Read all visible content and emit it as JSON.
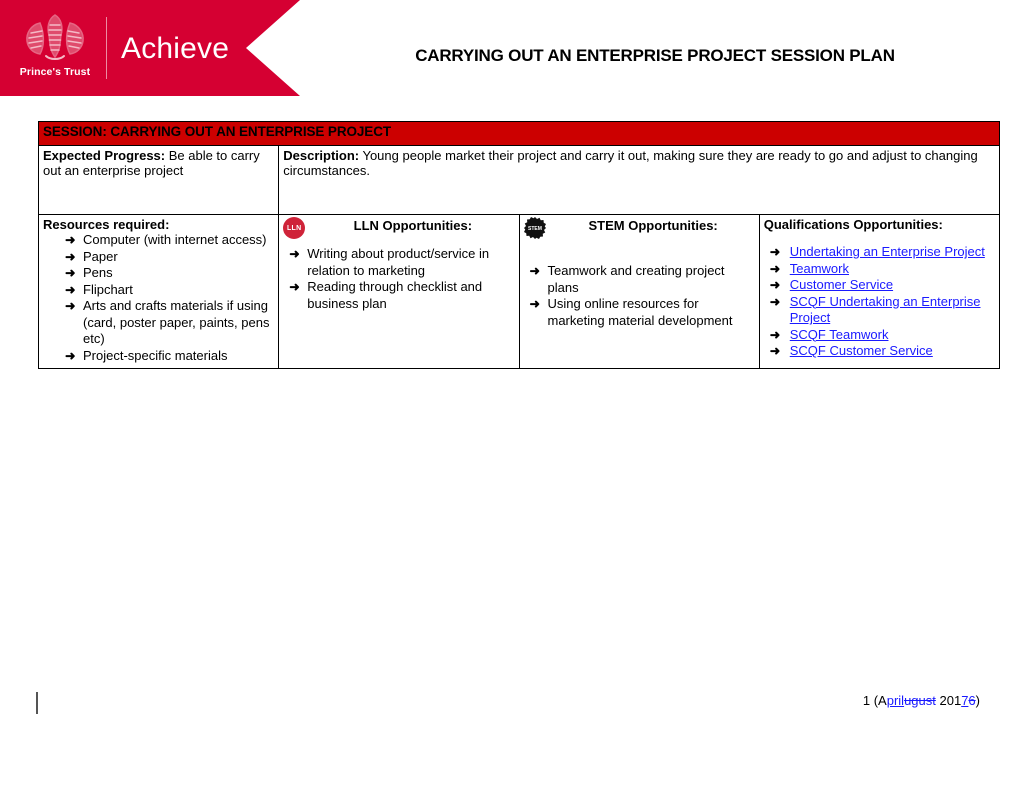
{
  "header": {
    "logo_wordmark": "Prince's Trust",
    "brand": "Achieve",
    "brand_color": "#d50032",
    "document_title": "CARRYING OUT AN ENTERPRISE PROJECT SESSION PLAN"
  },
  "table": {
    "session_header": "SESSION: CARRYING OUT AN ENTERPRISE PROJECT",
    "session_header_bg": "#cc0000",
    "expected_progress": {
      "label": "Expected Progress:",
      "text": " Be able to carry out an enterprise project"
    },
    "description": {
      "label": "Description:",
      "text": " Young people market their project and carry it out, making sure they are ready to go and adjust to changing circumstances."
    },
    "resources": {
      "label": "Resources required:",
      "items": [
        "Computer (with internet access)",
        "Paper",
        "Pens",
        "Flipchart",
        "Arts and crafts materials if using (card, poster paper, paints, pens etc)",
        "Project-specific materials"
      ]
    },
    "lln": {
      "badge": "LLN",
      "badge_color": "#cf2339",
      "label": "LLN Opportunities:",
      "items": [
        "Writing about product/service in relation to marketing",
        "Reading through checklist and business plan"
      ]
    },
    "stem": {
      "badge": "STEM",
      "badge_color": "#000000",
      "label": "STEM Opportunities:",
      "items": [
        "Teamwork and creating project plans",
        "Using online resources for marketing material development"
      ]
    },
    "qualifications": {
      "label": "Qualifications Opportunities:",
      "link_color": "#1a1aff",
      "items": [
        "Undertaking an Enterprise Project",
        "Teamwork",
        "Customer Service",
        "SCQF Undertaking an Enterprise Project",
        "SCQF Teamwork",
        "SCQF Customer Service"
      ]
    }
  },
  "footer": {
    "page_prefix": "1 (A",
    "month_inserted": "pril",
    "month_deleted": "ugust",
    "year_prefix": " 201",
    "year_inserted": "7",
    "year_deleted": "6",
    "suffix": ")"
  },
  "icons": {
    "arrow_bullet": "➜"
  }
}
